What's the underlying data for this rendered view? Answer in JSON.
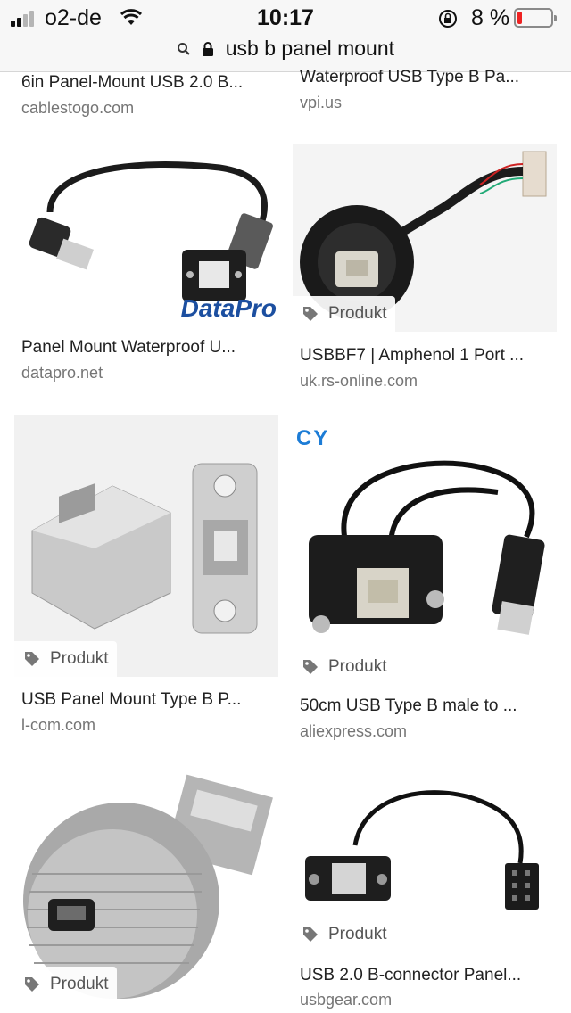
{
  "status": {
    "carrier": "o2-de",
    "time": "10:17",
    "battery_pct": "8 %"
  },
  "url": {
    "text": "usb b panel mount"
  },
  "badge_label": "Produkt",
  "results": [
    {
      "title": "6in Panel-Mount USB 2.0 B...",
      "domain": "cablestogo.com"
    },
    {
      "title": "Waterproof USB Type B Pa...",
      "domain": "vpi.us"
    },
    {
      "title": "Panel Mount Waterproof U...",
      "domain": "datapro.net",
      "brand": "DataPro"
    },
    {
      "title": "USBBF7 | Amphenol 1 Port ...",
      "domain": "uk.rs-online.com"
    },
    {
      "title": "USB Panel Mount Type B P...",
      "domain": "l-com.com"
    },
    {
      "title": "50cm USB Type B male to ...",
      "domain": "aliexpress.com",
      "brand": "CY"
    },
    {
      "title": "",
      "domain": ""
    },
    {
      "title": "USB 2.0 B-connector Panel...",
      "domain": "usbgear.com"
    }
  ]
}
